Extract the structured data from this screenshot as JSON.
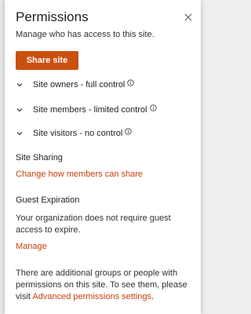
{
  "panel": {
    "title": "Permissions",
    "subtitle": "Manage who has access to this site.",
    "close_icon": "close-icon",
    "share_button": "Share site",
    "accent_color": "#ca5010",
    "link_color": "#c4420c"
  },
  "groups": [
    {
      "label": "Site owners - full control",
      "icon": "chevron-down-icon",
      "info_icon": "info-icon"
    },
    {
      "label": "Site members - limited control",
      "icon": "chevron-down-icon",
      "info_icon": "info-icon"
    },
    {
      "label": "Site visitors - no control",
      "icon": "chevron-down-icon",
      "info_icon": "info-icon"
    }
  ],
  "site_sharing": {
    "heading": "Site Sharing",
    "link": "Change how members can share"
  },
  "guest_expiration": {
    "heading": "Guest Expiration",
    "text": "Your organization does not require guest access to expire.",
    "link": "Manage"
  },
  "footer": {
    "text": "There are additional groups or people with permissions on this site. To see them, please visit ",
    "link": "Advanced permissions settings",
    "end": "."
  }
}
